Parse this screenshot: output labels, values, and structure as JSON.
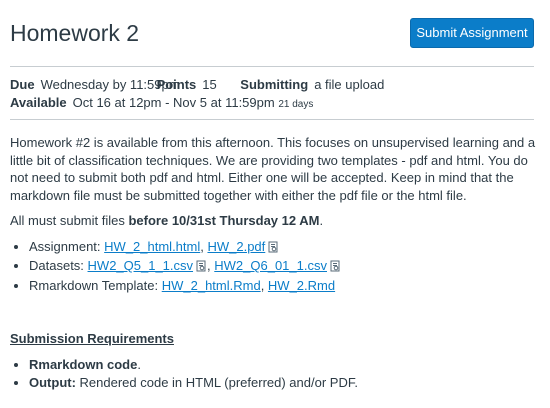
{
  "header": {
    "title": "Homework 2",
    "submit_label": "Submit Assignment"
  },
  "details": {
    "due_label": "Due",
    "due_value": "Wednesday by 11:59pm",
    "points_label": "Points",
    "points_value": "15",
    "submitting_label": "Submitting",
    "submitting_value": "a file upload",
    "available_label": "Available",
    "available_value": "Oct 16 at 12pm - Nov 5 at 11:59pm",
    "available_days": "21 days"
  },
  "description": {
    "paragraph1": "Homework #2 is available from this afternoon. This focuses on unsupervised learning and a little bit of classification techniques. We are providing two templates - pdf and html. You do not need to submit both pdf and html. Either one will be accepted. Keep in mind that the markdown file must be submitted together with either the pdf file or the html file.",
    "paragraph2_prefix": "All must submit files ",
    "paragraph2_bold": "before 10/31st Thursday 12 AM",
    "paragraph2_suffix": ".",
    "items": [
      {
        "label": "Assignment: ",
        "links": [
          "HW_2_html.html",
          "HW_2.pdf"
        ]
      },
      {
        "label": "Datasets: ",
        "links": [
          "HW2_Q5_1_1.csv",
          "HW2_Q6_01_1.csv"
        ]
      },
      {
        "label": "Rmarkdown Template: ",
        "links": [
          "HW_2_html.Rmd",
          "HW_2.Rmd"
        ]
      }
    ]
  },
  "requirements": {
    "title": "Submission Requirements",
    "item1_bold": "Rmarkdown code",
    "item1_rest": ".",
    "item2_bold": "Output:",
    "item2_rest": " Rendered code in HTML (preferred) and/or PDF."
  },
  "colors": {
    "accent": "#0b7dc9",
    "text": "#2d3b45",
    "rule": "#c7cdd1"
  },
  "icons": [
    "file-preview-icon"
  ]
}
